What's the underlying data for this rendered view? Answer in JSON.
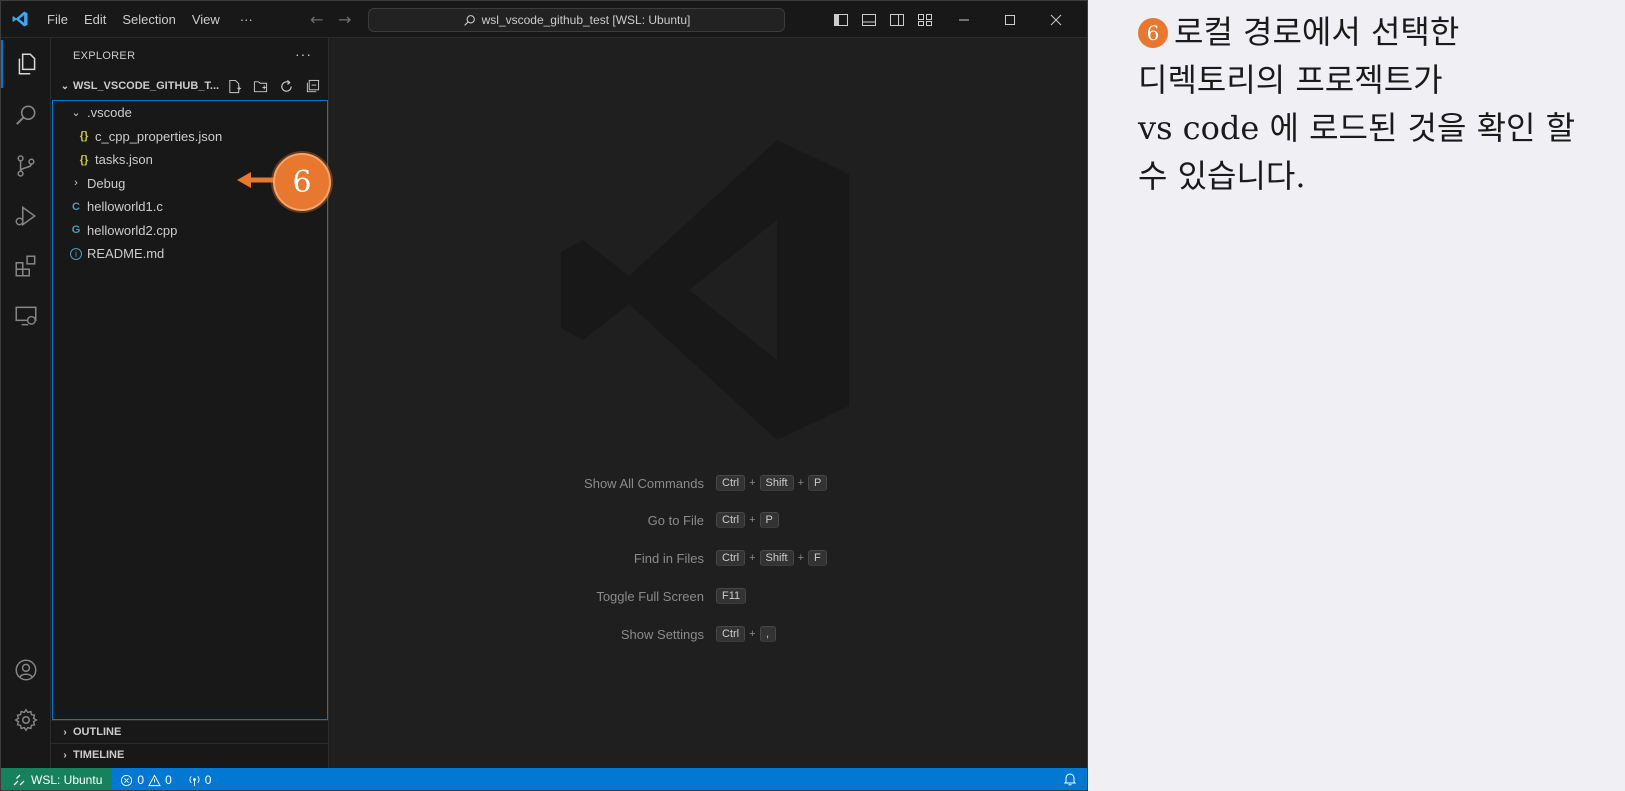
{
  "titlebar": {
    "menus": [
      "File",
      "Edit",
      "Selection",
      "View",
      "···"
    ],
    "command_center": "wsl_vscode_github_test [WSL: Ubuntu]"
  },
  "sidebar": {
    "header": "EXPLORER",
    "more": "···",
    "folder": "WSL_VSCODE_GITHUB_T...",
    "tree": [
      {
        "label": ".vscode",
        "icon": "chevron-down",
        "indent": 1
      },
      {
        "label": "c_cpp_properties.json",
        "icon": "json",
        "icon_text": "{}",
        "indent": 2
      },
      {
        "label": "tasks.json",
        "icon": "json",
        "icon_text": "{}",
        "indent": 2
      },
      {
        "label": "Debug",
        "icon": "chevron-right",
        "indent": 1
      },
      {
        "label": "helloworld1.c",
        "icon": "c-file",
        "icon_text": "C",
        "indent": 1
      },
      {
        "label": "helloworld2.cpp",
        "icon": "cpp-file",
        "icon_text": "G",
        "indent": 1
      },
      {
        "label": "README.md",
        "icon": "info",
        "icon_text": "i",
        "indent": 1
      }
    ],
    "outline": "OUTLINE",
    "timeline": "TIMELINE"
  },
  "editor": {
    "shortcuts": [
      {
        "label": "Show All Commands",
        "keys": [
          "Ctrl",
          "Shift",
          "P"
        ]
      },
      {
        "label": "Go to File",
        "keys": [
          "Ctrl",
          "P"
        ]
      },
      {
        "label": "Find in Files",
        "keys": [
          "Ctrl",
          "Shift",
          "F"
        ]
      },
      {
        "label": "Toggle Full Screen",
        "keys": [
          "F11"
        ]
      },
      {
        "label": "Show Settings",
        "keys": [
          "Ctrl",
          ","
        ]
      }
    ]
  },
  "statusbar": {
    "remote": "WSL: Ubuntu",
    "errors": "0",
    "warnings": "0",
    "ports": "0"
  },
  "callout": {
    "number": "6"
  },
  "annotation": {
    "badge": "6",
    "lines": [
      "로컬 경로에서 선택한",
      "디렉토리의 프로젝트가",
      "vs code 에 로드된 것을 확인 할",
      "수 있습니다."
    ]
  },
  "colors": {
    "accent": "#0078d4",
    "remote": "#16825d",
    "callout": "#e8782f",
    "json_icon": "#cbcb41",
    "c_icon": "#519aba"
  }
}
